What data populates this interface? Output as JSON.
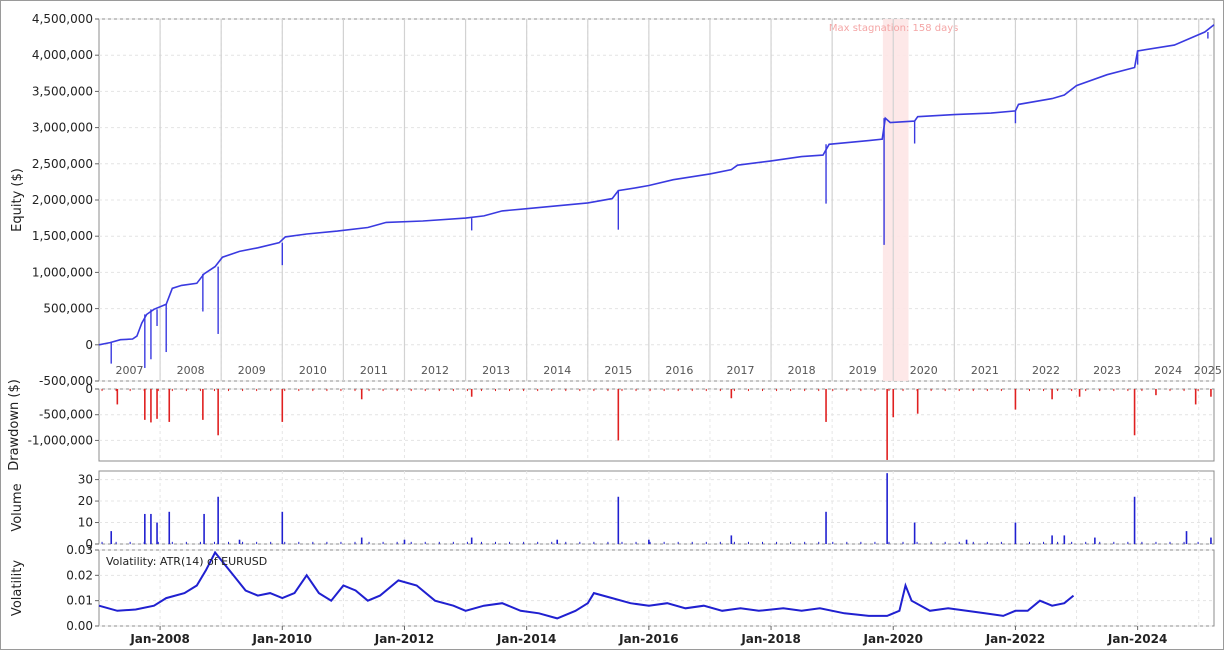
{
  "chart_data": [
    {
      "panel": "equity",
      "type": "line",
      "ylabel": "Equity ($)",
      "ylim": [
        -500000,
        4500000
      ],
      "yticks": [
        "4,500,000",
        "4,000,000",
        "3,500,000",
        "3,000,000",
        "2,500,000",
        "2,000,000",
        "1,500,000",
        "1,000,000",
        "500,000",
        "0",
        "-500,000"
      ],
      "ytick_values": [
        4500000,
        4000000,
        3500000,
        3000000,
        2500000,
        2000000,
        1500000,
        1000000,
        500000,
        0,
        -500000
      ],
      "year_labels": [
        "2007",
        "2008",
        "2009",
        "2010",
        "2011",
        "2012",
        "2013",
        "2014",
        "2015",
        "2016",
        "2017",
        "2018",
        "2019",
        "2020",
        "2021",
        "2022",
        "2023",
        "2024",
        "2025"
      ],
      "annotation": "Max stagnation: 158 days",
      "stagnation_range": [
        2019.83,
        2020.25
      ],
      "color": "#3a3ae0",
      "points": [
        [
          2007.0,
          0
        ],
        [
          2007.18,
          30000
        ],
        [
          2007.35,
          70000
        ],
        [
          2007.55,
          80000
        ],
        [
          2007.62,
          120000
        ],
        [
          2007.7,
          300000
        ],
        [
          2007.78,
          420000
        ],
        [
          2007.9,
          490000
        ],
        [
          2008.1,
          560000
        ],
        [
          2008.2,
          780000
        ],
        [
          2008.35,
          820000
        ],
        [
          2008.6,
          850000
        ],
        [
          2008.72,
          980000
        ],
        [
          2008.9,
          1080000
        ],
        [
          2009.02,
          1210000
        ],
        [
          2009.3,
          1290000
        ],
        [
          2009.6,
          1340000
        ],
        [
          2009.95,
          1410000
        ],
        [
          2010.05,
          1490000
        ],
        [
          2010.4,
          1530000
        ],
        [
          2010.9,
          1570000
        ],
        [
          2011.4,
          1620000
        ],
        [
          2011.7,
          1690000
        ],
        [
          2012.3,
          1710000
        ],
        [
          2013.0,
          1750000
        ],
        [
          2013.3,
          1780000
        ],
        [
          2013.6,
          1850000
        ],
        [
          2014.0,
          1880000
        ],
        [
          2014.5,
          1920000
        ],
        [
          2015.0,
          1960000
        ],
        [
          2015.4,
          2020000
        ],
        [
          2015.5,
          2130000
        ],
        [
          2015.8,
          2170000
        ],
        [
          2016.0,
          2200000
        ],
        [
          2016.4,
          2280000
        ],
        [
          2017.0,
          2360000
        ],
        [
          2017.35,
          2420000
        ],
        [
          2017.45,
          2480000
        ],
        [
          2018.0,
          2540000
        ],
        [
          2018.5,
          2600000
        ],
        [
          2018.85,
          2620000
        ],
        [
          2018.95,
          2770000
        ],
        [
          2019.6,
          2820000
        ],
        [
          2019.82,
          2840000
        ],
        [
          2019.87,
          3130000
        ],
        [
          2019.95,
          3070000
        ],
        [
          2020.35,
          3090000
        ],
        [
          2020.4,
          3150000
        ],
        [
          2021.0,
          3180000
        ],
        [
          2021.6,
          3200000
        ],
        [
          2022.0,
          3230000
        ],
        [
          2022.05,
          3320000
        ],
        [
          2022.6,
          3400000
        ],
        [
          2022.8,
          3450000
        ],
        [
          2023.0,
          3580000
        ],
        [
          2023.5,
          3730000
        ],
        [
          2023.95,
          3830000
        ],
        [
          2024.0,
          4060000
        ],
        [
          2024.6,
          4140000
        ],
        [
          2025.1,
          4320000
        ],
        [
          2025.25,
          4420000
        ]
      ]
    },
    {
      "panel": "drawdown",
      "type": "bar",
      "ylabel": "Drawdown ($)",
      "ylim": [
        -1400000,
        0
      ],
      "yticks": [
        "0",
        "-500,000",
        "-1,000,000"
      ],
      "ytick_values": [
        0,
        -500000,
        -1000000
      ],
      "color": "#e02020",
      "x": [
        2007.3,
        2007.75,
        2007.85,
        2007.95,
        2008.15,
        2008.7,
        2008.95,
        2010.0,
        2011.3,
        2013.1,
        2015.5,
        2017.35,
        2018.9,
        2019.9,
        2020.0,
        2020.4,
        2022.0,
        2022.6,
        2023.05,
        2023.95,
        2024.3,
        2024.95,
        2025.2
      ],
      "values": [
        -300000,
        -600000,
        -650000,
        -580000,
        -640000,
        -600000,
        -900000,
        -640000,
        -200000,
        -150000,
        -1000000,
        -180000,
        -640000,
        -1380000,
        -550000,
        -480000,
        -400000,
        -200000,
        -150000,
        -900000,
        -120000,
        -300000,
        -150000
      ]
    },
    {
      "panel": "volume",
      "type": "bar",
      "ylabel": "Volume",
      "ylim": [
        0,
        34
      ],
      "yticks": [
        "30",
        "20",
        "10",
        "0"
      ],
      "ytick_values": [
        30,
        20,
        10,
        0
      ],
      "color": "#2020d0",
      "x": [
        2007.2,
        2007.75,
        2007.85,
        2007.95,
        2008.15,
        2008.72,
        2008.95,
        2009.3,
        2010.0,
        2011.3,
        2012.0,
        2013.1,
        2014.5,
        2015.5,
        2016.0,
        2017.35,
        2018.9,
        2019.9,
        2020.35,
        2021.2,
        2022.0,
        2022.6,
        2022.8,
        2023.3,
        2023.95,
        2024.8,
        2025.2
      ],
      "values": [
        6,
        14,
        14,
        10,
        15,
        14,
        22,
        2,
        15,
        3,
        2,
        3,
        2,
        22,
        2,
        4,
        15,
        33,
        10,
        2,
        10,
        4,
        4,
        3,
        22,
        6,
        3
      ]
    },
    {
      "panel": "volatility",
      "type": "line",
      "ylabel": "Volatility",
      "legend": "Volatility: ATR(14) of EURUSD",
      "ylim": [
        0,
        0.03
      ],
      "yticks": [
        "0.03",
        "0.02",
        "0.01",
        "0.00"
      ],
      "ytick_values": [
        0.03,
        0.02,
        0.01,
        0.0
      ],
      "xticks": [
        "Jan-2008",
        "Jan-2010",
        "Jan-2012",
        "Jan-2014",
        "Jan-2016",
        "Jan-2018",
        "Jan-2020",
        "Jan-2022",
        "Jan-2024"
      ],
      "xtick_values": [
        2008.0,
        2010.0,
        2012.0,
        2014.0,
        2016.0,
        2018.0,
        2020.0,
        2022.0,
        2024.0
      ],
      "color": "#2020d0",
      "points": [
        [
          2007.0,
          0.008
        ],
        [
          2007.3,
          0.006
        ],
        [
          2007.6,
          0.0065
        ],
        [
          2007.9,
          0.008
        ],
        [
          2008.1,
          0.011
        ],
        [
          2008.4,
          0.013
        ],
        [
          2008.6,
          0.016
        ],
        [
          2008.75,
          0.022
        ],
        [
          2008.9,
          0.029
        ],
        [
          2009.0,
          0.026
        ],
        [
          2009.2,
          0.02
        ],
        [
          2009.4,
          0.014
        ],
        [
          2009.6,
          0.012
        ],
        [
          2009.8,
          0.013
        ],
        [
          2010.0,
          0.011
        ],
        [
          2010.2,
          0.013
        ],
        [
          2010.4,
          0.02
        ],
        [
          2010.6,
          0.013
        ],
        [
          2010.8,
          0.01
        ],
        [
          2011.0,
          0.016
        ],
        [
          2011.2,
          0.014
        ],
        [
          2011.4,
          0.01
        ],
        [
          2011.6,
          0.012
        ],
        [
          2011.9,
          0.018
        ],
        [
          2012.2,
          0.016
        ],
        [
          2012.5,
          0.01
        ],
        [
          2012.8,
          0.008
        ],
        [
          2013.0,
          0.006
        ],
        [
          2013.3,
          0.008
        ],
        [
          2013.6,
          0.009
        ],
        [
          2013.9,
          0.006
        ],
        [
          2014.2,
          0.005
        ],
        [
          2014.5,
          0.003
        ],
        [
          2014.8,
          0.006
        ],
        [
          2015.0,
          0.009
        ],
        [
          2015.1,
          0.013
        ],
        [
          2015.4,
          0.011
        ],
        [
          2015.7,
          0.009
        ],
        [
          2016.0,
          0.008
        ],
        [
          2016.3,
          0.009
        ],
        [
          2016.6,
          0.007
        ],
        [
          2016.9,
          0.008
        ],
        [
          2017.2,
          0.006
        ],
        [
          2017.5,
          0.007
        ],
        [
          2017.8,
          0.006
        ],
        [
          2018.2,
          0.007
        ],
        [
          2018.5,
          0.006
        ],
        [
          2018.8,
          0.007
        ],
        [
          2019.2,
          0.005
        ],
        [
          2019.6,
          0.004
        ],
        [
          2019.9,
          0.004
        ],
        [
          2020.1,
          0.006
        ],
        [
          2020.2,
          0.016
        ],
        [
          2020.3,
          0.01
        ],
        [
          2020.6,
          0.006
        ],
        [
          2020.9,
          0.007
        ],
        [
          2021.2,
          0.006
        ],
        [
          2021.5,
          0.005
        ],
        [
          2021.8,
          0.004
        ],
        [
          2022.0,
          0.006
        ],
        [
          2022.2,
          0.006
        ],
        [
          2022.4,
          0.01
        ],
        [
          2022.6,
          0.008
        ],
        [
          2022.8,
          0.009
        ],
        [
          2022.95,
          0.012
        ]
      ]
    }
  ]
}
